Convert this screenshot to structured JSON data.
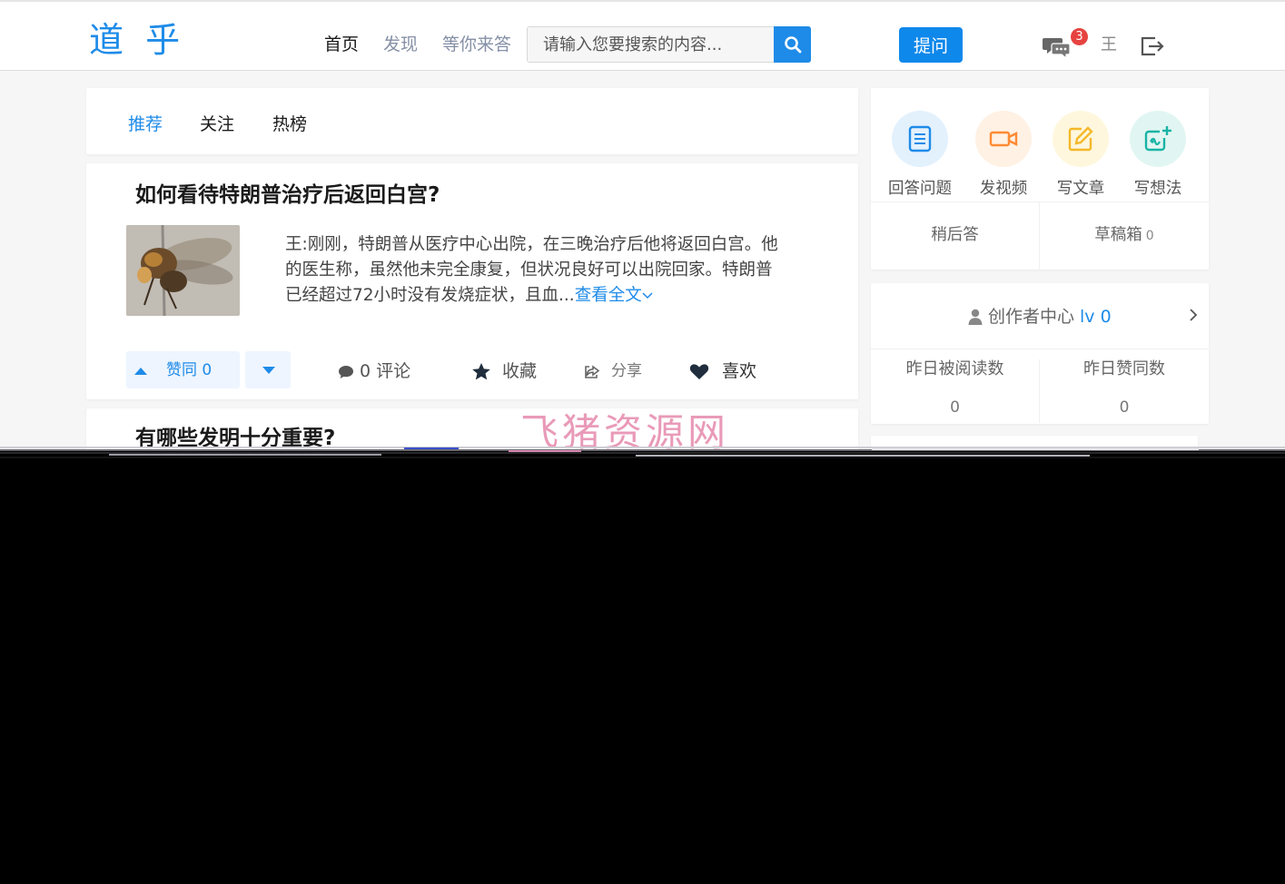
{
  "header": {
    "logo": "道 乎",
    "nav": [
      "首页",
      "发现",
      "等你来答"
    ],
    "search_placeholder": "请输入您要搜索的内容...",
    "ask_button": "提问",
    "message_badge": "3",
    "user_name": "王"
  },
  "tabs": [
    "推荐",
    "关注",
    "热榜"
  ],
  "feed": [
    {
      "title": "如何看待特朗普治疗后返回白宫?",
      "excerpt": "王:刚刚，特朗普从医疗中心出院，在三晚治疗后他将返回白宫。他的医生称，虽然他未完全康复，但状况良好可以出院回家。特朗普已经超过72小时没有发烧症状，且血...",
      "read_more": "查看全文",
      "actions": {
        "vote_up": "赞同 0",
        "comments": "0 评论",
        "favorite": "收藏",
        "share": "分享",
        "like": "喜欢"
      }
    },
    {
      "title": "有哪些发明十分重要?"
    }
  ],
  "watermark": "飞猪资源网",
  "sidebar": {
    "create": [
      {
        "label": "回答问题",
        "icon": "document-icon",
        "color": "#1e8be8",
        "bg": "#e3f1fd"
      },
      {
        "label": "发视频",
        "icon": "video-camera-icon",
        "color": "#ff8a33",
        "bg": "#fff1e3"
      },
      {
        "label": "写文章",
        "icon": "edit-icon",
        "color": "#f5b829",
        "bg": "#fff7dd"
      },
      {
        "label": "写想法",
        "icon": "idea-plus-icon",
        "color": "#19b3a5",
        "bg": "#e1f6f2"
      }
    ],
    "later_answer": "稍后答",
    "drafts": "草稿箱",
    "drafts_count": "0",
    "creator_center": "创作者中心",
    "creator_level": "lv 0",
    "stats": [
      {
        "label": "昨日被阅读数",
        "value": "0"
      },
      {
        "label": "昨日赞同数",
        "value": "0"
      }
    ]
  }
}
